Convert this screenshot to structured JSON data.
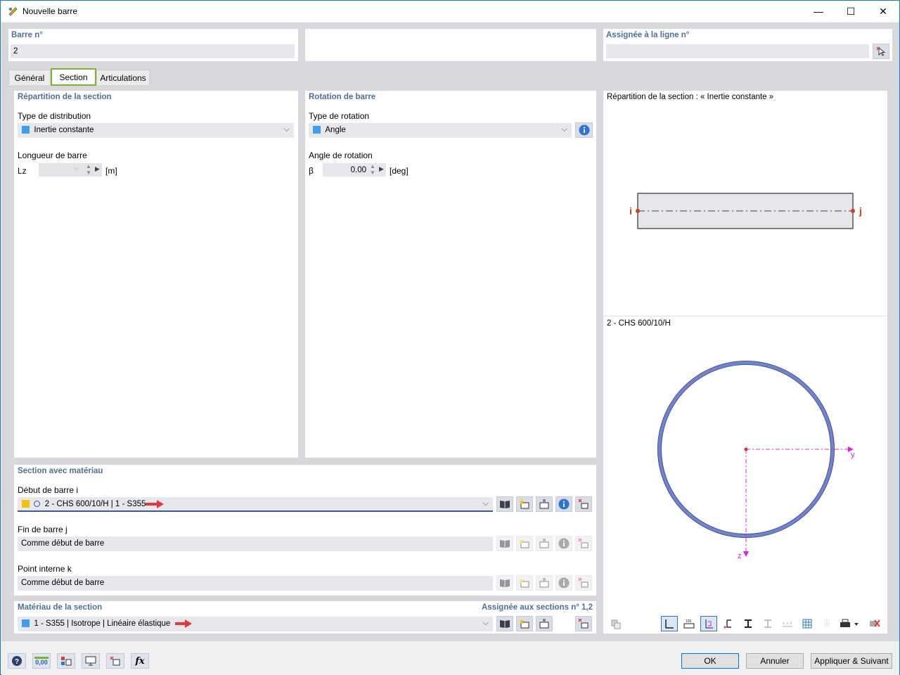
{
  "window": {
    "title": "Nouvelle barre",
    "minimize": "—",
    "maximize": "☐",
    "close": "✕"
  },
  "top": {
    "member_no_label": "Barre n°",
    "member_no_value": "2",
    "assigned_label": "Assignée à la ligne n°",
    "assigned_value": ""
  },
  "tabs": [
    {
      "label": "Général"
    },
    {
      "label": "Section"
    },
    {
      "label": "Articulations"
    }
  ],
  "distribution": {
    "header": "Répartition de la section",
    "type_label": "Type de distribution",
    "type_value": "Inertie constante",
    "length_label": "Longueur de barre",
    "lz_symbol": "Lz",
    "lz_unit": "[m]",
    "lz_value": ""
  },
  "rotation": {
    "header": "Rotation de barre",
    "type_label": "Type de rotation",
    "type_value": "Angle",
    "angle_label": "Angle de rotation",
    "beta_symbol": "β",
    "beta_value": "0.00",
    "beta_unit": "[deg]"
  },
  "section_material": {
    "header": "Section avec matériau",
    "start_label": "Début de barre i",
    "start_value": "2 - CHS 600/10/H | 1 - S355",
    "end_label": "Fin de barre j",
    "end_value": "Comme début de barre",
    "internal_label": "Point interne k",
    "internal_value": "Comme début de barre",
    "start_color": "#f5c400"
  },
  "material": {
    "header": "Matériau de la section",
    "assigned": "Assignée aux sections n° 1,2",
    "value": "1 - S355 | Isotrope | Linéaire élastique"
  },
  "preview": {
    "distribution_title": "Répartition de la section : « Inertie constante »",
    "node_i": "i",
    "node_j": "j",
    "section_title": "2 - CHS 600/10/H",
    "axis_y": "y",
    "axis_z": "z"
  },
  "buttons": {
    "ok": "OK",
    "cancel": "Annuler",
    "apply_next": "Appliquer & Suivant",
    "value_badge": "0,00"
  },
  "colors": {
    "accent_blue": "#4d6f9b",
    "tab_highlight": "#7ab52b",
    "arrow_red": "#e03a3a",
    "axis_magenta": "#e020e0",
    "node_red": "#d23c1e"
  }
}
